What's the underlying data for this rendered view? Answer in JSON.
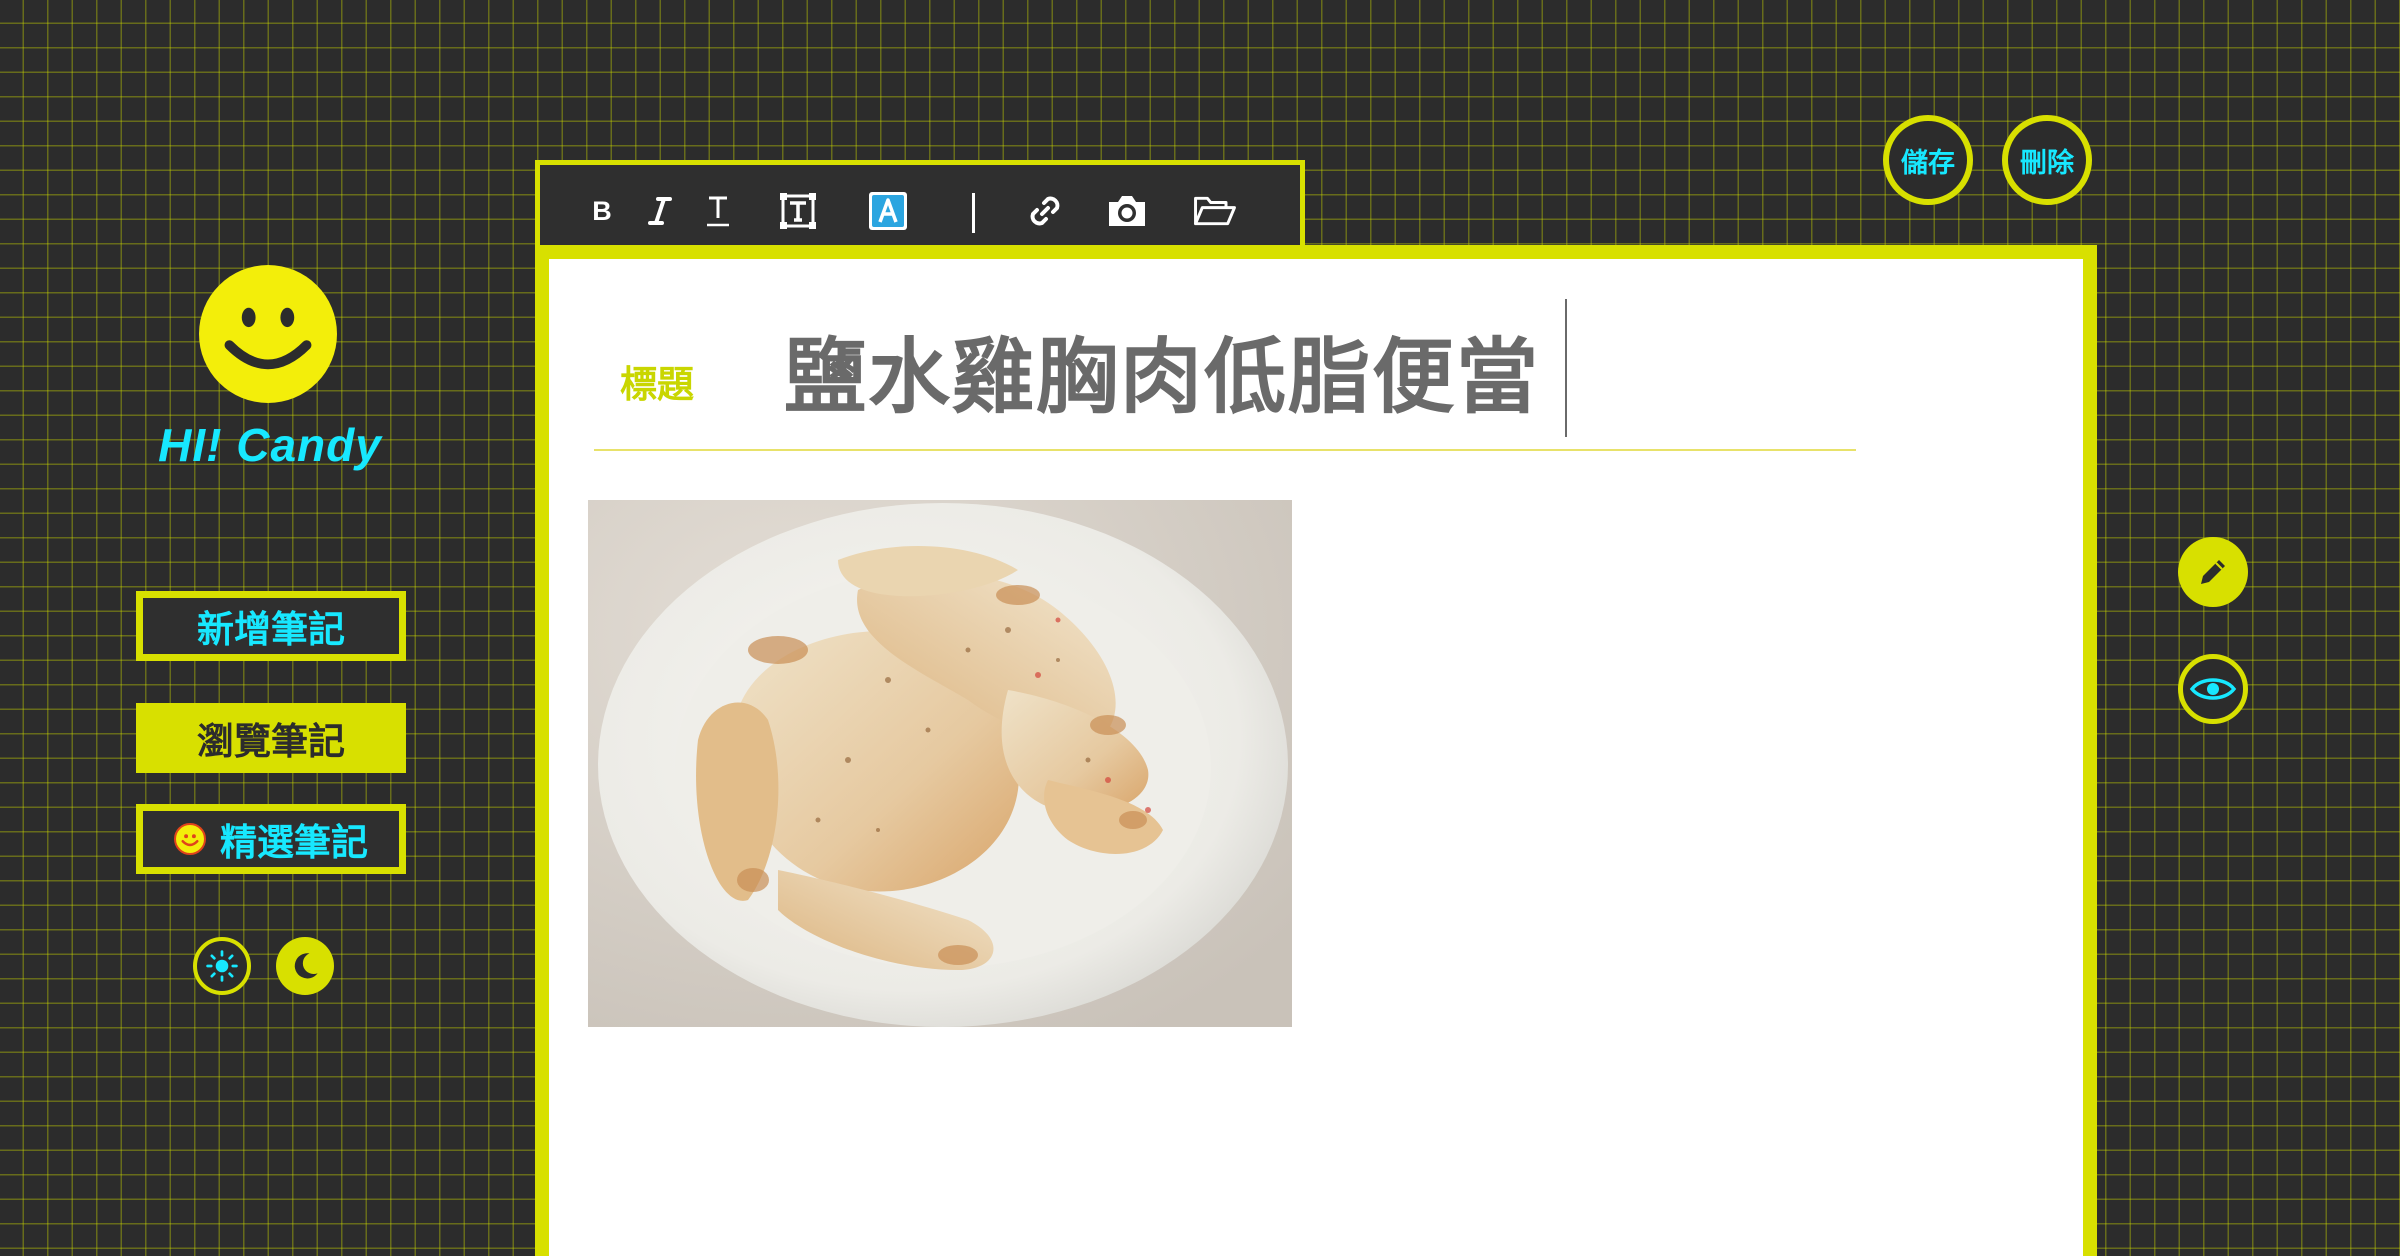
{
  "app": {
    "greeting": "HI! Candy"
  },
  "sidebar": {
    "items": [
      {
        "label": "新增筆記",
        "state": "outlined"
      },
      {
        "label": "瀏覽筆記",
        "state": "filled"
      },
      {
        "label": "精選筆記",
        "state": "outlined",
        "icon": "smiley-icon"
      }
    ],
    "theme_toggles": [
      {
        "icon": "sun-icon",
        "mode": "light"
      },
      {
        "icon": "moon-icon",
        "mode": "dark"
      }
    ]
  },
  "toolbar": {
    "bold_label": "B",
    "tools": [
      "bold-icon",
      "italic-icon",
      "text-icon",
      "textbox-icon",
      "text-color-icon",
      "link-icon",
      "camera-icon",
      "folder-open-icon"
    ]
  },
  "actions": {
    "save_label": "儲存",
    "delete_label": "刪除"
  },
  "modes": [
    {
      "icon": "pencil-icon",
      "active": true
    },
    {
      "icon": "eye-icon",
      "active": false
    }
  ],
  "note": {
    "title_label": "標題",
    "title_value": "鹽水雞胸肉低脂便當",
    "image": "photo of sliced grilled chicken breast on a white plate"
  },
  "colors": {
    "accent_yellow": "#d8e000",
    "accent_cyan": "#17e8ff",
    "background": "#2c2c2c",
    "smiley": "#f3ee0a"
  }
}
